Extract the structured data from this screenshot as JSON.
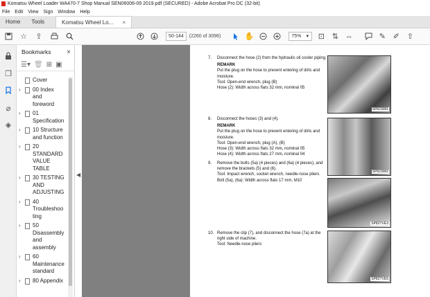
{
  "window": {
    "title": "Komatsu Wheel Loader WA470-7 Shop Manual SEN06006-09 2019.pdf (SECURED) - Adobe Acrobat Pro DC (32-bit)"
  },
  "menu": [
    "File",
    "Edit",
    "View",
    "Sign",
    "Window",
    "Help"
  ],
  "tabs": {
    "home": "Home",
    "tools": "Tools",
    "document": "Komatsu Wheel Lo...",
    "close": "×"
  },
  "toolbar": {
    "page_field": "50-144",
    "page_count": "(2260 of 3096)",
    "zoom": "75%",
    "icons": [
      "save-icon",
      "bookmark-icon",
      "upload-icon",
      "print-icon",
      "search-icon",
      "page-up-icon",
      "page-down-icon",
      "select-cursor-icon",
      "hand-icon",
      "zoom-out-icon",
      "zoom-in-icon",
      "fit-page-icon",
      "scroll-mode-icon",
      "tools-icon",
      "comment-icon",
      "sign-icon",
      "highlight-icon",
      "share-icon"
    ]
  },
  "bookmarks": {
    "title": "Bookmarks",
    "close": "×",
    "items": [
      {
        "label": "Cover",
        "expandable": false
      },
      {
        "label": "00 Index and foreword",
        "expandable": true
      },
      {
        "label": "01 Specification",
        "expandable": true
      },
      {
        "label": "10 Structure and function",
        "expandable": true
      },
      {
        "label": "20 STANDARD VALUE TABLE",
        "expandable": true
      },
      {
        "label": "30 TESTING AND ADJUSTING",
        "expandable": true
      },
      {
        "label": "40 Troubleshooting",
        "expandable": true
      },
      {
        "label": "50 Disassembly and assembly",
        "expandable": true
      },
      {
        "label": "60 Maintenance standard",
        "expandable": true
      },
      {
        "label": "80 Appendix",
        "expandable": true
      }
    ]
  },
  "document": {
    "steps": [
      {
        "num": "7.",
        "lines": [
          "Disconnect the hose (2) from the hydraulic oil cooler piping."
        ],
        "remark": "REMARK",
        "after": [
          "Put the plug on the hose to prevent entering of dirts and moisture.",
          "Tool: Open-end wrench, plug (B)",
          "Hose (2): Width across flats 32 mm, nominal 05"
        ]
      },
      {
        "num": "8.",
        "lines": [
          "Disconnect the hoses (3) and (4)."
        ],
        "remark": "REMARK",
        "after": [
          "Put the plug on the hose to prevent entering of dirts and moisture.",
          "Tool: Open-end wrench, plug (A), (B)",
          "Hose (3): Width across flats 32 mm, nominal 05",
          "Hose (4): Width across flats 27 mm, nominal 04"
        ]
      },
      {
        "num": "9.",
        "lines": [
          "Remove the bolts (5a) (4 pieces) and (6a) (4 pieces), and remove the brackets (5) and (6)."
        ],
        "remark": "",
        "after": [
          "Tool: Impact wrench, socket wrench, needle-nose pliers",
          "Bolt (5a), (6a): Width across flats 17 mm, M10"
        ]
      },
      {
        "num": "10.",
        "lines": [
          "Remove the clip (7), and disconnect the hose (7a) at the right side of machine."
        ],
        "remark": "",
        "after": [
          "Tool: Needle-nose pliers"
        ]
      }
    ],
    "photo_captions": [
      "SP823081",
      "SP823082",
      "SP82TVE3",
      "SP82TVE5"
    ]
  }
}
